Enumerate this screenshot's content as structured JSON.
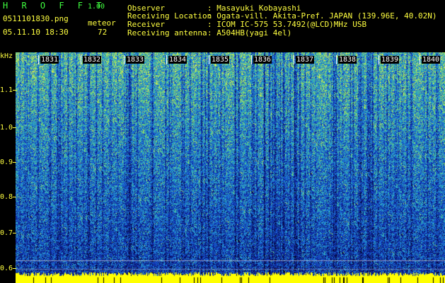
{
  "app": {
    "title": "H R O F F T",
    "version": "1.00"
  },
  "file": {
    "filename": "0511101830.png",
    "datetime": "05.11.10 18:30"
  },
  "meteor": {
    "label": "meteor",
    "count": "72"
  },
  "info": {
    "labels": [
      "Observer",
      "Receiving Location",
      "Receiver",
      "Receiving antenna"
    ],
    "values": [
      ": Masayuki Kobayashi",
      ": Ogata-vill. Akita-Pref. JAPAN (139.96E, 40.02N)",
      ": ICOM IC-575 53.7492(@LCD)MHz USB",
      ": A504HB(yagi 4el)"
    ]
  },
  "spectrogram": {
    "y_unit": "kHz",
    "y_ticks": [
      "1.1",
      "1.0",
      "0.9",
      "0.8",
      "0.7",
      "0.6"
    ],
    "y_range_khz": [
      0.6,
      1.16
    ],
    "time_labels": [
      "1831",
      "1832",
      "1833",
      "1834",
      "1835",
      "1836",
      "1837",
      "1838",
      "1839",
      "1840"
    ],
    "colors": {
      "background": "#000000",
      "header_text": "#ffff40",
      "title_text": "#40ff40",
      "baseline": "#ffff00"
    }
  }
}
